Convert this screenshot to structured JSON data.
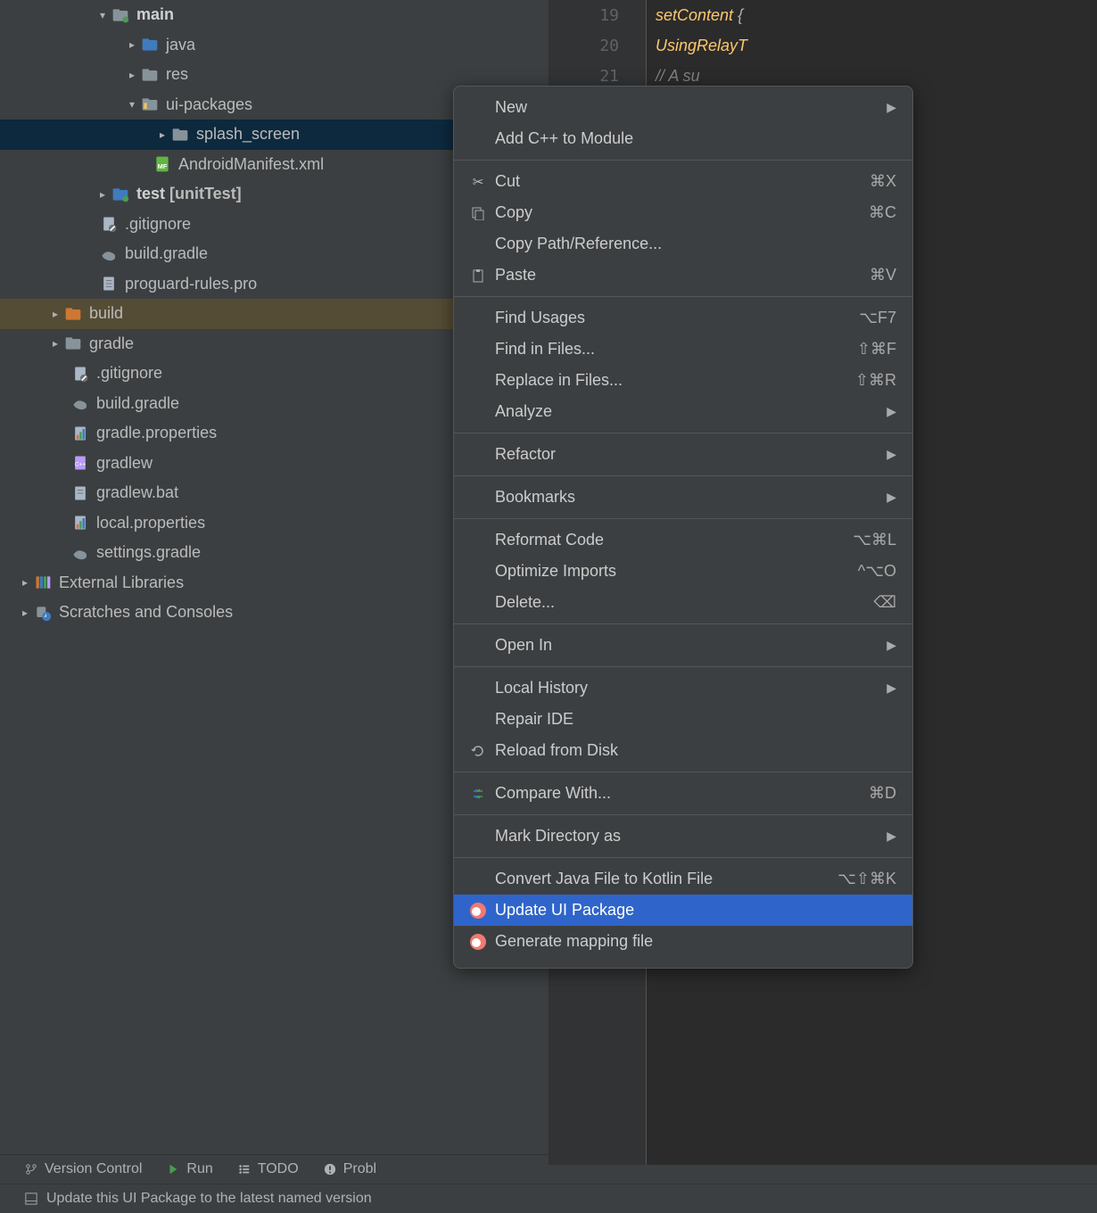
{
  "tree": {
    "main": "main",
    "java": "java",
    "res": "res",
    "ui_packages": "ui-packages",
    "splash_screen": "splash_screen",
    "manifest": "AndroidManifest.xml",
    "test": "test",
    "test_suffix": "[unitTest]",
    "gitignore_a": ".gitignore",
    "build_gradle_a": "build.gradle",
    "proguard": "proguard-rules.pro",
    "build": "build",
    "gradle": "gradle",
    "gitignore_b": ".gitignore",
    "build_gradle_b": "build.gradle",
    "gradle_props": "gradle.properties",
    "gradlew": "gradlew",
    "gradlew_bat": "gradlew.bat",
    "local_props": "local.properties",
    "settings_gradle": "settings.gradle",
    "ext_lib": "External Libraries",
    "scratches": "Scratches and Consoles"
  },
  "editor": {
    "lines": [
      "19",
      "20",
      "21"
    ],
    "code_setcontent": "setContent",
    "code_brace": " {",
    "code_using": "UsingRelayT",
    "code_comment": "// A su"
  },
  "menu": {
    "new": "New",
    "addcpp": "Add C++ to Module",
    "cut": "Cut",
    "cut_k": "⌘X",
    "copy": "Copy",
    "copy_k": "⌘C",
    "copypath": "Copy Path/Reference...",
    "paste": "Paste",
    "paste_k": "⌘V",
    "findusages": "Find Usages",
    "findusages_k": "⌥F7",
    "findfiles": "Find in Files...",
    "findfiles_k": "⇧⌘F",
    "replacefiles": "Replace in Files...",
    "replacefiles_k": "⇧⌘R",
    "analyze": "Analyze",
    "refactor": "Refactor",
    "bookmarks": "Bookmarks",
    "reformat": "Reformat Code",
    "reformat_k": "⌥⌘L",
    "optimize": "Optimize Imports",
    "optimize_k": "^⌥O",
    "delete": "Delete...",
    "delete_k": "⌫",
    "openin": "Open In",
    "localhist": "Local History",
    "repair": "Repair IDE",
    "reload": "Reload from Disk",
    "compare": "Compare With...",
    "compare_k": "⌘D",
    "markdir": "Mark Directory as",
    "convert": "Convert Java File to Kotlin File",
    "convert_k": "⌥⇧⌘K",
    "update_ui": "Update UI Package",
    "genmap": "Generate mapping file"
  },
  "bottombar": {
    "vc": "Version Control",
    "run": "Run",
    "todo": "TODO",
    "problems": "Probl"
  },
  "status": "Update this UI Package to the latest named version"
}
